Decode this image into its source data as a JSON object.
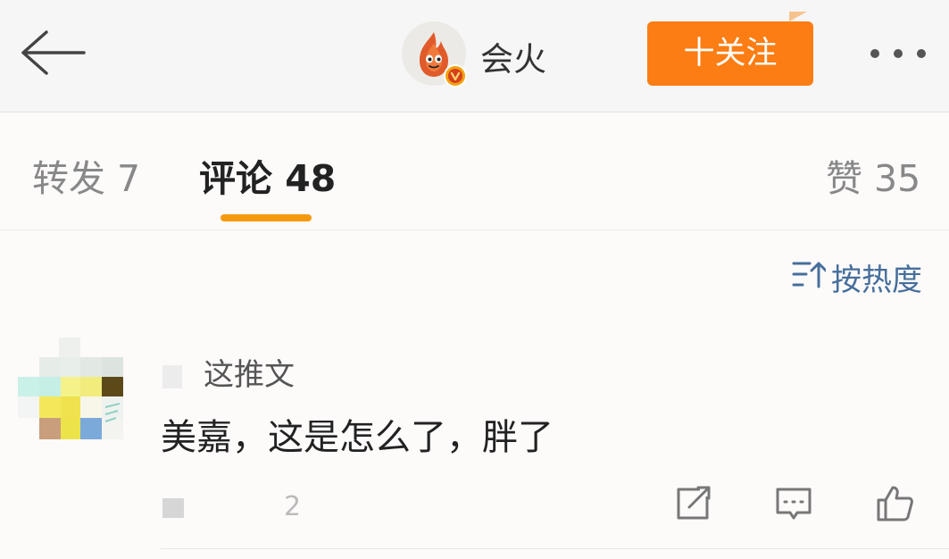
{
  "header": {
    "back_icon": "arrow-left-icon",
    "username": "会火",
    "verified_icon": "verified-badge-icon",
    "follow_label": "十关注",
    "follow_color": "#fb7d13",
    "more_icon": "more-dots-icon"
  },
  "tabs": [
    {
      "label": "转发 7",
      "active": false
    },
    {
      "label": "评论 48",
      "active": true
    },
    {
      "label": "赞 35",
      "active": false
    }
  ],
  "accent_color": "#f59a0d",
  "sort": {
    "icon": "sort-hot-icon",
    "label": "按热度",
    "color": "#466f9b"
  },
  "comment": {
    "author": "这推文",
    "text": "美嘉，这是怎么了，胖了",
    "meta": "2",
    "actions": {
      "share_icon": "share-icon",
      "reply_icon": "comment-icon",
      "like_icon": "thumbs-up-icon"
    }
  }
}
